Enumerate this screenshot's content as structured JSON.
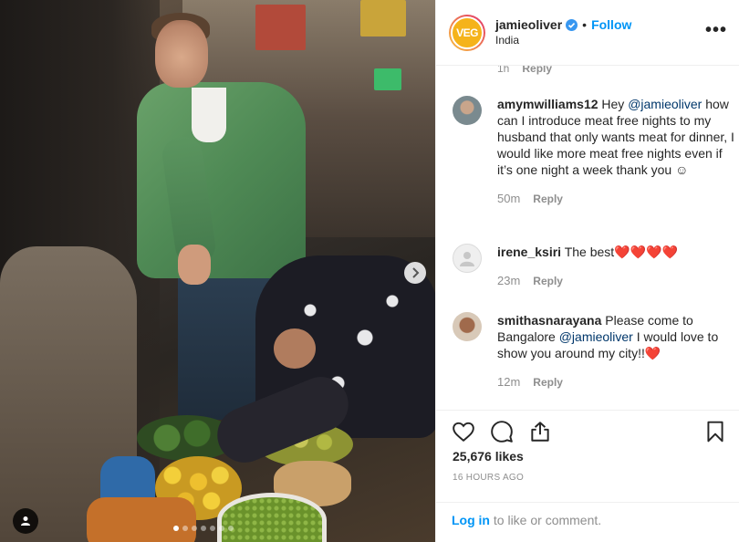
{
  "post": {
    "username": "jamieoliver",
    "avatar_text": "VEG",
    "follow_label": "Follow",
    "separator": "•",
    "location": "India",
    "more_label": "•••",
    "photo_dots": 7,
    "photo_active_dot": 0
  },
  "comments": {
    "previous_meta": {
      "age": "1h",
      "reply": "Reply"
    },
    "items": [
      {
        "username": "amymwilliams12",
        "text_before": " Hey ",
        "mention": "@jamieoliver",
        "text_after": " how can I introduce meat free nights to my husband that only wants meat for dinner, I would like more meat free nights even if it’s one night a week thank you ☺",
        "age": "50m",
        "reply": "Reply"
      },
      {
        "username": "irene_ksiri",
        "text_before": " The best❤️❤️❤️❤️",
        "mention": "",
        "text_after": "",
        "age": "23m",
        "reply": "Reply"
      },
      {
        "username": "smithasnarayana",
        "text_before": " Please come to Bangalore ",
        "mention": "@jamieoliver",
        "text_after": " I would love to show you around my city!!❤️",
        "age": "12m",
        "reply": "Reply"
      }
    ]
  },
  "actions": {
    "likes": "25,676 likes",
    "age": "16 HOURS AGO",
    "login_link": "Log in",
    "login_suffix": " to like or comment."
  },
  "icons": {
    "verified": "verified-badge-icon",
    "heart": "heart-icon",
    "comment": "comment-icon",
    "share": "share-icon",
    "save": "bookmark-icon",
    "next": "chevron-right-icon",
    "user_tag": "user-tag-icon"
  },
  "colors": {
    "accent": "#0095f6",
    "mention": "#00376b",
    "muted": "#8e8e8e",
    "text": "#262626",
    "border": "#efefef",
    "avatar_bg": "#f5b31a"
  }
}
